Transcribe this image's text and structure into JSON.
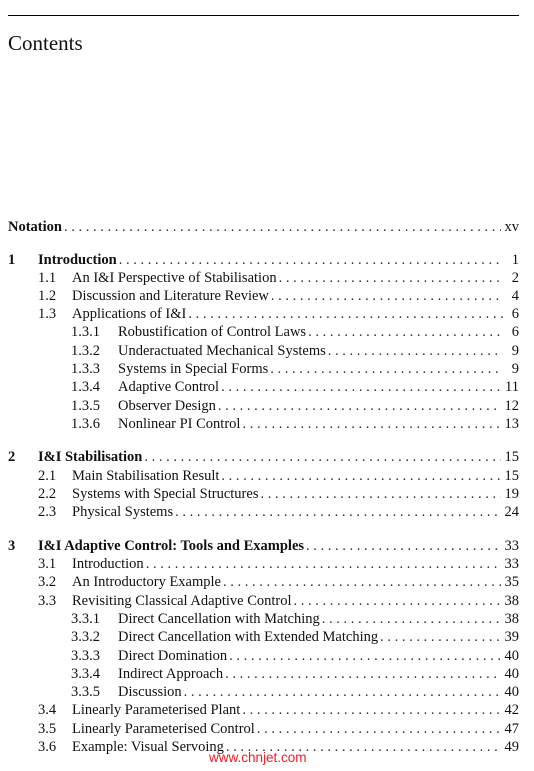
{
  "page": {
    "title": "Contents",
    "watermark": "www.chnjet.com"
  },
  "toc": [
    {
      "level": 0,
      "number": "",
      "label": "Notation",
      "page": "xv",
      "bold": true
    },
    {
      "level": 0,
      "number": "1",
      "label": "Introduction",
      "page": "1",
      "bold": true
    },
    {
      "level": 1,
      "number": "1.1",
      "label": "An I&I Perspective of Stabilisation",
      "page": "2"
    },
    {
      "level": 1,
      "number": "1.2",
      "label": "Discussion and Literature Review",
      "page": "4"
    },
    {
      "level": 1,
      "number": "1.3",
      "label": "Applications of I&I",
      "page": "6"
    },
    {
      "level": 2,
      "number": "1.3.1",
      "label": "Robustification of Control Laws",
      "page": "6"
    },
    {
      "level": 2,
      "number": "1.3.2",
      "label": "Underactuated Mechanical Systems",
      "page": "9"
    },
    {
      "level": 2,
      "number": "1.3.3",
      "label": "Systems in Special Forms",
      "page": "9"
    },
    {
      "level": 2,
      "number": "1.3.4",
      "label": "Adaptive Control",
      "page": "11"
    },
    {
      "level": 2,
      "number": "1.3.5",
      "label": "Observer Design",
      "page": "12"
    },
    {
      "level": 2,
      "number": "1.3.6",
      "label": "Nonlinear PI Control",
      "page": "13"
    },
    {
      "level": 0,
      "number": "2",
      "label": "I&I Stabilisation",
      "page": "15",
      "bold": true
    },
    {
      "level": 1,
      "number": "2.1",
      "label": "Main Stabilisation Result",
      "page": "15"
    },
    {
      "level": 1,
      "number": "2.2",
      "label": "Systems with Special Structures",
      "page": "19"
    },
    {
      "level": 1,
      "number": "2.3",
      "label": "Physical Systems",
      "page": "24"
    },
    {
      "level": 0,
      "number": "3",
      "label": "I&I Adaptive Control: Tools and Examples",
      "page": "33",
      "bold": true
    },
    {
      "level": 1,
      "number": "3.1",
      "label": "Introduction",
      "page": "33"
    },
    {
      "level": 1,
      "number": "3.2",
      "label": "An Introductory Example",
      "page": "35"
    },
    {
      "level": 1,
      "number": "3.3",
      "label": "Revisiting Classical Adaptive Control",
      "page": "38"
    },
    {
      "level": 2,
      "number": "3.3.1",
      "label": "Direct Cancellation with Matching",
      "page": "38"
    },
    {
      "level": 2,
      "number": "3.3.2",
      "label": "Direct Cancellation with Extended Matching",
      "page": "39"
    },
    {
      "level": 2,
      "number": "3.3.3",
      "label": "Direct Domination",
      "page": "40"
    },
    {
      "level": 2,
      "number": "3.3.4",
      "label": "Indirect Approach",
      "page": "40"
    },
    {
      "level": 2,
      "number": "3.3.5",
      "label": "Discussion",
      "page": "40"
    },
    {
      "level": 1,
      "number": "3.4",
      "label": "Linearly Parameterised Plant",
      "page": "42"
    },
    {
      "level": 1,
      "number": "3.5",
      "label": "Linearly Parameterised Control",
      "page": "47"
    },
    {
      "level": 1,
      "number": "3.6",
      "label": "Example: Visual Servoing",
      "page": "49"
    }
  ]
}
